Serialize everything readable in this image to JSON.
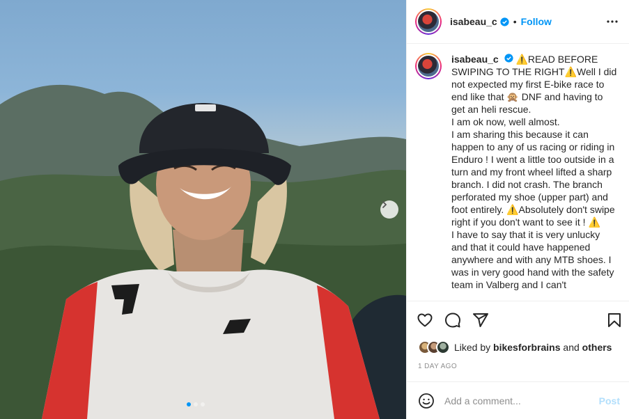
{
  "post": {
    "username": "isabeau_c",
    "follow_label": "Follow",
    "separator": "•",
    "caption": "⚠️READ BEFORE SWIPING TO THE RIGHT⚠️Well I did not expected my first E-bike race to end like that 🙊 DNF and having to get an heli rescue.\nI am ok now, well almost.\nI am sharing this because it can happen to any of us racing or riding in Enduro ! I went a little too outside in a turn and my front wheel lifted a sharp branch. I did not crash. The branch perforated my shoe (upper part) and foot entirely. ⚠️Absolutely don't swipe right if you don't want to see it ! ⚠️\nI have to say that it is very unlucky and that it could have happened anywhere and with any MTB shoes. I was in very good hand with the safety team in Valberg and I can't",
    "likes_prefix": "Liked by",
    "likes_user": "bikesforbrains",
    "likes_and": "and",
    "likes_others": "others",
    "timestamp": "1 DAY AGO",
    "comment_placeholder": "Add a comment...",
    "post_label": "Post"
  },
  "carousel": {
    "current": 1,
    "total": 3
  },
  "icons": {
    "verified": "verified-badge-icon",
    "more": "more-options-icon",
    "like": "heart-icon",
    "comment": "comment-bubble-icon",
    "share": "paper-plane-icon",
    "save": "bookmark-icon",
    "emoji": "smiley-icon",
    "next": "chevron-right-icon"
  },
  "colors": {
    "accent": "#0095f6",
    "post_disabled": "#b2dffc",
    "muted": "#8e8e8e"
  }
}
